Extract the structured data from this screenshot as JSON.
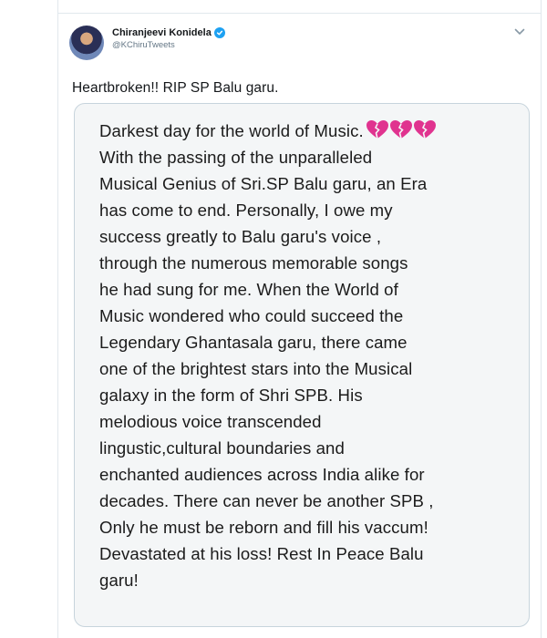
{
  "tweet": {
    "author": {
      "display_name": "Chiranjeevi Konidela",
      "handle": "@KChiruTweets",
      "verified": true
    },
    "text": "Heartbroken!! RIP SP Balu garu.",
    "media": {
      "lines": [
        "Darkest day for the world of Music.",
        "With the passing of the unparalleled",
        "Musical Genius of Sri.SP Balu garu, an Era",
        "has come to end. Personally, I owe my",
        "success greatly to Balu garu's voice ,",
        "through the numerous memorable songs",
        "he had sung for me. When the World of",
        "Music wondered who could succeed the",
        "Legendary Ghantasala garu, there came",
        "one of the brightest stars into the Musical",
        "galaxy in the form of Shri SPB. His",
        "melodious voice transcended",
        "lingustic,cultural boundaries and",
        "enchanted audiences across India alike for",
        "decades. There can never be another SPB ,",
        "Only he must be reborn and fill his vaccum!",
        "Devastated at his loss! Rest In Peace Balu",
        "garu!"
      ],
      "emoji": "broken-heart-icon",
      "emoji_count": 3
    }
  },
  "colors": {
    "verified_blue": "#1da1f2",
    "broken_heart": "#e0338f",
    "border": "#e1e8ed",
    "text": "#14171a",
    "muted": "#657786"
  }
}
